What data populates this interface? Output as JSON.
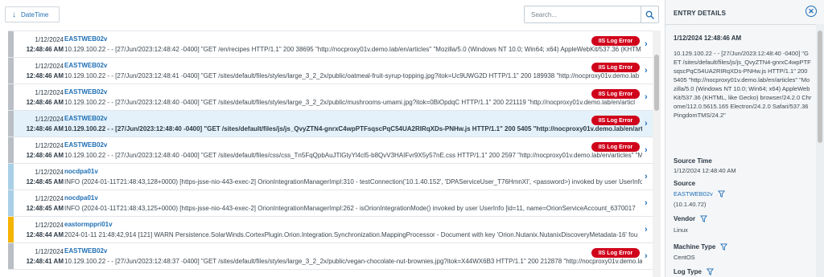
{
  "toolbar": {
    "sort_label": "DateTime",
    "search_placeholder": "Search..."
  },
  "badge_label": "IIS Log Error",
  "rows": [
    {
      "date": "1/12/2024",
      "time": "12:48:46 AM",
      "host": "EASTWEB02v",
      "message": "10.129.100.22 - - [27/Jun/2023:12:48:42 -0400] \"GET /en/recipes HTTP/1.1\" 200 38695 \"http://nocproxy01v.demo.lab/en/articles\" \"Mozilla/5.0 (Windows NT 10.0; Win64; x64) AppleWebKit/537.36 (KHTM",
      "badge": true,
      "stripe": "#b9bfc4",
      "selected": false
    },
    {
      "date": "1/12/2024",
      "time": "12:48:46 AM",
      "host": "EASTWEB02v",
      "message": "10.129.100.22 - - [27/Jun/2023:12:48:41 -0400] \"GET /sites/default/files/styles/large_3_2_2x/public/oatmeal-fruit-syrup-topping.jpg?itok=Uc9UWG2D HTTP/1.1\" 200 189938 \"http://nocproxy01v.demo.lab",
      "badge": true,
      "stripe": "#b9bfc4",
      "selected": false
    },
    {
      "date": "1/12/2024",
      "time": "12:48:46 AM",
      "host": "EASTWEB02v",
      "message": "10.129.100.22 - - [27/Jun/2023:12:48:40 -0400] \"GET /sites/default/files/styles/large_3_2_2x/public/mushrooms-umami.jpg?itok=0BiOpdqC HTTP/1.1\" 200 221119 \"http://nocproxy01v.demo.lab/en/articl",
      "badge": true,
      "stripe": "#b9bfc4",
      "selected": false
    },
    {
      "date": "1/12/2024",
      "time": "12:48:46 AM",
      "host": "EASTWEB02v",
      "message": "10.129.100.22 - - [27/Jun/2023:12:48:40 -0400] \"GET /sites/default/files/js/js_QvyZTN4-gnrxC4wpPTFsqscPqC54UA2RIRqXDs-PNHw.js HTTP/1.1\" 200 5405 \"http://nocproxy01v.demo.lab/en/art",
      "badge": true,
      "stripe": "#b9bfc4",
      "selected": true
    },
    {
      "date": "1/12/2024",
      "time": "12:48:46 AM",
      "host": "EASTWEB02v",
      "message": "10.129.100.22 - - [27/Jun/2023:12:48:40 -0400] \"GET /sites/default/files/css/css_Tn5FqQpbAuJTlGtyYl4cl5-b8QvV3HAIFvr9X5y57nE.css HTTP/1.1\" 200 2597 \"http://nocproxy01v.demo.lab/en/articles\" \"Mo",
      "badge": true,
      "stripe": "#b9bfc4",
      "selected": false
    },
    {
      "date": "1/12/2024",
      "time": "12:48:45 AM",
      "host": "nocdpa01v",
      "message": "INFO (2024-01-11T21:48:43,128+0000) [https-jsse-nio-443-exec-2] OrionIntegrationManagerImpl:310 - testConnection('10.1.40.152', 'DPAServiceUser_T76HmnXI', <password>) invoked by user UserInfo",
      "badge": false,
      "stripe": "#a9cfe6",
      "selected": false
    },
    {
      "date": "1/12/2024",
      "time": "12:48:45 AM",
      "host": "nocdpa01v",
      "message": "INFO (2024-01-11T21:48:43,125+0000) [https-jsse-nio-443-exec-2] OrionIntegrationManagerImpl:262 - isOrionIntegrationMode() invoked by user UserInfo [id=11, name=OrionServiceAccount_6370017",
      "badge": false,
      "stripe": "#a9cfe6",
      "selected": false
    },
    {
      "date": "1/12/2024",
      "time": "12:48:44 AM",
      "host": "eastormppri01v",
      "message": "2024-01-11 21:48:42,914 [121] WARN Persistence.SolarWinds.CortexPlugin.Orion.Integration.Synchronization.MappingProcessor - Document with key 'Orion.Nutanix.NutanixDiscoveryMetadata-16' fou",
      "badge": false,
      "stripe": "#f5b400",
      "selected": false
    },
    {
      "date": "1/12/2024",
      "time": "12:48:41 AM",
      "host": "EASTWEB02v",
      "message": "10.129.100.22 - - [27/Jun/2023:12:48:37 -0400] \"GET /sites/default/files/styles/large_3_2_2x/public/vegan-chocolate-nut-brownies.jpg?itok=X44WX6B3 HTTP/1.1\" 200 212878 \"http://nocproxy01v.demo.lab",
      "badge": true,
      "stripe": "#b9bfc4",
      "selected": false
    }
  ],
  "panel": {
    "title": "ENTRY DETAILS",
    "timestamp": "1/12/2024 12:48:46 AM",
    "message": "10.129.100.22 - - [27/Jun/2023:12:48:40 -0400] \"GET /sites/default/files/js/js_QvyZTN4-gnrxC4wpPTFsqscPqC54UA2RIRqXDs-PNHw.js HTTP/1.1\" 200 5405 \"http://nocproxy01v.demo.lab/en/articles\" \"Mozilla/5.0 (Windows NT 10.0; Win64; x64) AppleWebKit/537.36 (KHTML, like Gecko) browser/24.2.0 Chrome/112.0.5615.165 Electron/24.2.0 Safari/537.36 PingdomTMS/24.2\"",
    "source_time_label": "Source Time",
    "source_time_value": "1/12/2024 12:48:40 AM",
    "source_label": "Source",
    "source_link": "EASTWEB02v",
    "source_ip": "(10.1.40.72)",
    "vendor_label": "Vendor",
    "vendor_value": "Linux",
    "machine_type_label": "Machine Type",
    "machine_type_value": "CentOS",
    "log_type_label": "Log Type"
  }
}
